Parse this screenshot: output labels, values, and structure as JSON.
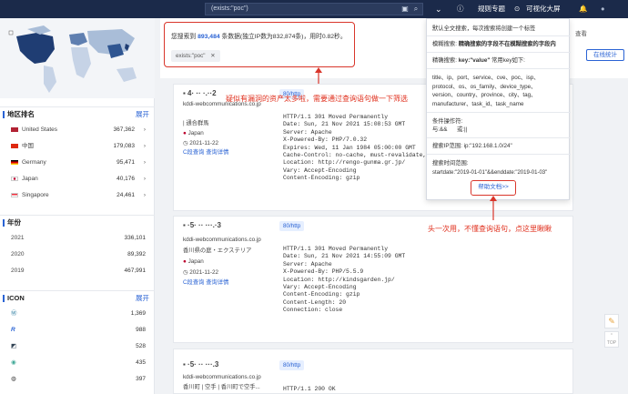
{
  "topbar": {
    "search_value": "(exists:\"poc\")",
    "nav_rules": "规则专题",
    "nav_screen": "可视化大屏"
  },
  "sidebar": {
    "region_title": "地区排名",
    "region_expand": "展开",
    "regions": [
      {
        "name": "United States",
        "value": "367,362",
        "color": "#b22234"
      },
      {
        "name": "中国",
        "value": "179,083",
        "color": "#de2910"
      },
      {
        "name": "Germany",
        "value": "95,471",
        "color": "#000000"
      },
      {
        "name": "Japan",
        "value": "40,176",
        "color": "#bc002d"
      },
      {
        "name": "Singapore",
        "value": "24,461",
        "color": "#ef3340"
      }
    ],
    "year_title": "年份",
    "years": [
      {
        "name": "2021",
        "value": "336,101"
      },
      {
        "name": "2020",
        "value": "89,392"
      },
      {
        "name": "2019",
        "value": "467,991"
      }
    ],
    "icon_title": "ICON",
    "icon_expand": "展开",
    "icons": [
      {
        "value": "1,369"
      },
      {
        "value": "988"
      },
      {
        "value": "528"
      },
      {
        "value": "435"
      },
      {
        "value": "397"
      }
    ]
  },
  "results": {
    "summary_prefix": "您搜索到",
    "count": "893,484",
    "summary_suffix": "条数据(独立IP数为832,874条)，用时0.82秒。",
    "query_tag": "exists:\"poc\"",
    "right_label": "查看",
    "stats_button": "在线统计"
  },
  "cards": [
    {
      "port": "80/http",
      "host": "kddi-webcommunications.co.jp",
      "org": "| 通合群馬",
      "country": "Japan",
      "date": "2021-11-22",
      "links": "C段查询  查询详情",
      "http": "HTTP/1.1 301 Moved Permanently\nDate: Sun, 21 Nov 2021 15:08:53 GMT\nServer: Apache\nX-Powered-By: PHP/7.0.32\nExpires: Wed, 11 Jan 1984 05:00:00 GMT\nCache-Control: no-cache, must-revalidate, max-\nLocation: http://rengo-gunma.gr.jp/\nVary: Accept-Encoding\nContent-Encoding: gzip"
    },
    {
      "port": "80/http",
      "host": "kddi-webcommunications.co.jp",
      "org": "香川県の庭・エクステリア",
      "country": "Japan",
      "date": "2021-11-22",
      "links": "C段查询  查询详情",
      "http": "HTTP/1.1 301 Moved Permanently\nDate: Sun, 21 Nov 2021 14:55:09 GMT\nServer: Apache\nX-Powered-By: PHP/5.5.9\nLocation: http://kindsgarden.jp/\nVary: Accept-Encoding\nContent-Encoding: gzip\nContent-Length: 20\nConnection: close"
    },
    {
      "port": "80/http",
      "host": "kddi-webcommunications.co.jp",
      "org": "香川町 | 空手 | 香川町で空手...",
      "http": "HTTP/1.1 200 OK"
    }
  ],
  "popup": {
    "line1": "默认全文搜索，每次搜索将创建一个标签",
    "line2_label": "模糊搜索:",
    "line2_value": "精确搜索的字段不在模糊搜索的字段内",
    "line3_label": "精确搜索:",
    "line3_key": "key:\"value\"",
    "line3_suffix": "常用key如下:",
    "keys": "title、ip、port、service、cve、poc、isp、\nprotocol、os、os_family、device_type、\nversion、country、province、city、tag、\nmanufacturer、task_id、task_name",
    "cond_label": "条件操作符:",
    "cond_value": "与:&&      或:||",
    "ip_label": "搜索IP范围:",
    "ip_value": "ip:\"192.168.1.0/24\"",
    "time_label": "搜索时间范围:",
    "time_value": "startdate:\"2019-01-01\"&&enddate:\"2019-01-03\"",
    "help": "帮助文档>>"
  },
  "annotations": {
    "a1": "疑似有漏洞的资产太多啦，需要通过查询语句做一下筛选",
    "a2": "头一次用，不懂查询语句，点这里瞅瞅"
  },
  "float_top": "TOP",
  "colors": {
    "accent": "#2a63d4",
    "annotation": "#d9362b",
    "topbar": "#1b2a4a"
  }
}
